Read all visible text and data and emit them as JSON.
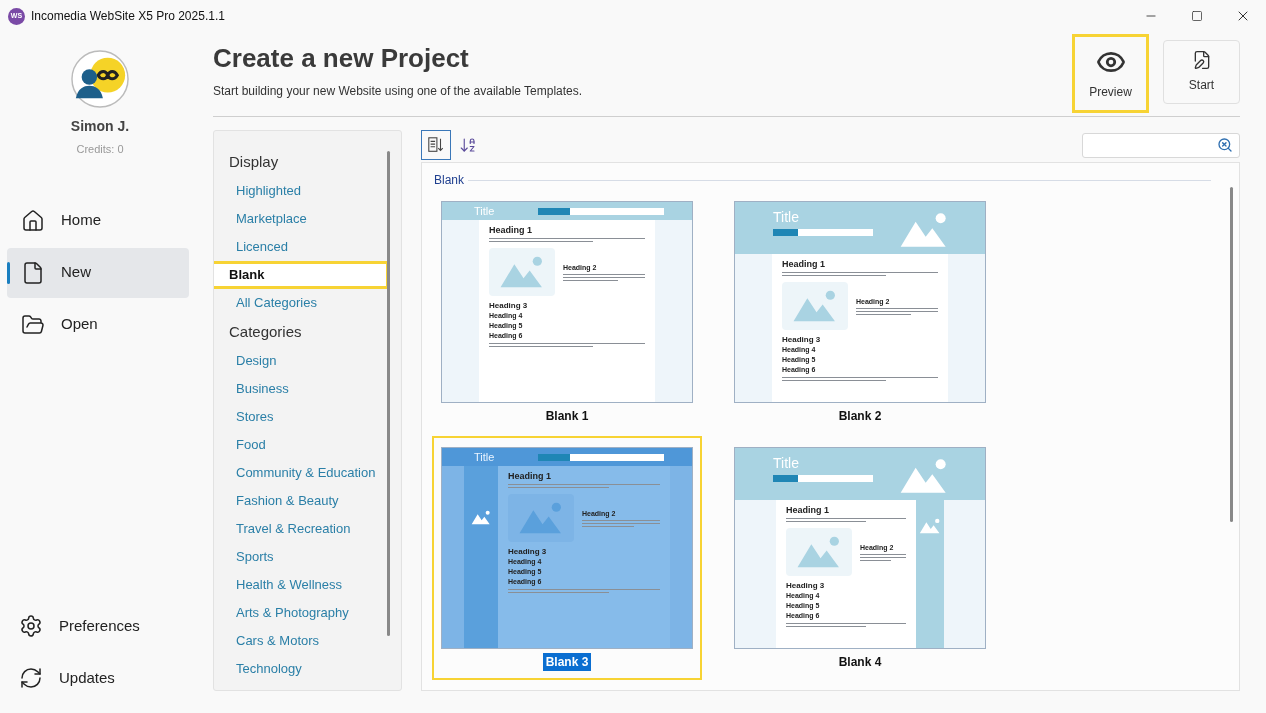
{
  "window": {
    "logo": "WS",
    "title": "Incomedia WebSite X5 Pro 2025.1.1"
  },
  "user": {
    "name": "Simon J.",
    "credits": "Credits: 0"
  },
  "nav": [
    {
      "label": "Home",
      "selected": false
    },
    {
      "label": "New",
      "selected": true
    },
    {
      "label": "Open",
      "selected": false
    }
  ],
  "nav_bottom": [
    {
      "label": "Preferences"
    },
    {
      "label": "Updates"
    }
  ],
  "header": {
    "title": "Create a new Project",
    "subtitle": "Start building your new Website using one of the available Templates."
  },
  "actions": [
    {
      "label": "Preview",
      "highlighted": true
    },
    {
      "label": "Start",
      "highlighted": false
    }
  ],
  "sidebar": {
    "sections": [
      {
        "heading": "Display",
        "items": [
          {
            "label": "Highlighted",
            "selected": false,
            "highlighted": false
          },
          {
            "label": "Marketplace",
            "selected": false,
            "highlighted": false
          },
          {
            "label": "Licenced",
            "selected": false,
            "highlighted": false
          },
          {
            "label": "Blank",
            "selected": true,
            "highlighted": true
          },
          {
            "label": "All Categories",
            "selected": false,
            "highlighted": false
          }
        ]
      },
      {
        "heading": "Categories",
        "items": [
          {
            "label": "Design",
            "selected": false,
            "highlighted": false
          },
          {
            "label": "Business",
            "selected": false,
            "highlighted": false
          },
          {
            "label": "Stores",
            "selected": false,
            "highlighted": false
          },
          {
            "label": "Food",
            "selected": false,
            "highlighted": false
          },
          {
            "label": "Community & Education",
            "selected": false,
            "highlighted": false
          },
          {
            "label": "Fashion & Beauty",
            "selected": false,
            "highlighted": false
          },
          {
            "label": "Travel & Recreation",
            "selected": false,
            "highlighted": false
          },
          {
            "label": "Sports",
            "selected": false,
            "highlighted": false
          },
          {
            "label": "Health & Wellness",
            "selected": false,
            "highlighted": false
          },
          {
            "label": "Arts & Photography",
            "selected": false,
            "highlighted": false
          },
          {
            "label": "Cars & Motors",
            "selected": false,
            "highlighted": false
          },
          {
            "label": "Technology",
            "selected": false,
            "highlighted": false
          }
        ]
      }
    ]
  },
  "templates": {
    "group": "Blank",
    "items": [
      {
        "name": "Blank 1",
        "kind": "topbar",
        "selected": false,
        "highlighted": false,
        "thumbnail": {
          "title": "Title",
          "headings": [
            "Heading 1",
            "Heading 2",
            "Heading 3",
            "Heading 4",
            "Heading 5",
            "Heading 6"
          ]
        }
      },
      {
        "name": "Blank 2",
        "kind": "banner",
        "selected": false,
        "highlighted": false,
        "thumbnail": {
          "title": "Title",
          "headings": [
            "Heading 1",
            "Heading 2",
            "Heading 3",
            "Heading 4",
            "Heading 5",
            "Heading 6"
          ]
        }
      },
      {
        "name": "Blank 3",
        "kind": "sidebar",
        "selected": true,
        "highlighted": true,
        "thumbnail": {
          "title": "Title",
          "headings": [
            "Heading 1",
            "Heading 2",
            "Heading 3",
            "Heading 4",
            "Heading 5",
            "Heading 6"
          ]
        }
      },
      {
        "name": "Blank 4",
        "kind": "banner-sidebar",
        "selected": false,
        "highlighted": false,
        "thumbnail": {
          "title": "Title",
          "headings": [
            "Heading 1",
            "Heading 2",
            "Heading 3",
            "Heading 4",
            "Heading 5",
            "Heading 6"
          ]
        }
      }
    ]
  }
}
